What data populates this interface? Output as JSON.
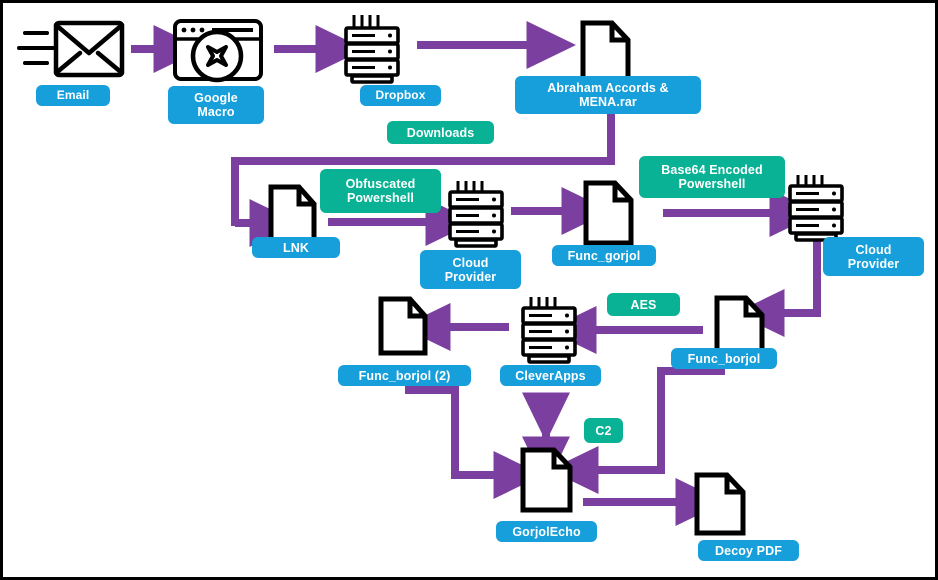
{
  "diagram": {
    "title": "Attack chain flow diagram",
    "colors": {
      "blue_label": "#169FDB",
      "teal_label": "#09B294",
      "arrow_purple": "#7B3FA0",
      "icon_black": "#000000",
      "background": "#FFFFFF",
      "border": "#000000"
    },
    "nodes": [
      {
        "id": "email",
        "label": "Email",
        "chip": "blue",
        "icon": "email-icon"
      },
      {
        "id": "google-macro",
        "label": "Google\nMacro",
        "chip": "blue",
        "icon": "browser-error-icon"
      },
      {
        "id": "dropbox",
        "label": "Dropbox",
        "chip": "blue",
        "icon": "server-icon"
      },
      {
        "id": "rar",
        "label": "Abraham Accords &\nMENA.rar",
        "chip": "blue",
        "icon": "document-icon"
      },
      {
        "id": "lnk",
        "label": "LNK",
        "chip": "blue",
        "icon": "document-icon"
      },
      {
        "id": "cloud1",
        "label": "Cloud\nProvider",
        "chip": "blue",
        "icon": "server-icon"
      },
      {
        "id": "func-gorjol",
        "label": "Func_gorjol",
        "chip": "blue",
        "icon": "document-icon"
      },
      {
        "id": "cloud2",
        "label": "Cloud\nProvider",
        "chip": "blue",
        "icon": "server-icon"
      },
      {
        "id": "func-borjol",
        "label": "Func_borjol",
        "chip": "blue",
        "icon": "document-icon"
      },
      {
        "id": "cleverapps",
        "label": "CleverApps",
        "chip": "blue",
        "icon": "server-icon"
      },
      {
        "id": "func-borjol2",
        "label": "Func_borjol (2)",
        "chip": "blue",
        "icon": "document-icon"
      },
      {
        "id": "gorjolecho",
        "label": "GorjolEcho",
        "chip": "blue",
        "icon": "document-icon"
      },
      {
        "id": "decoy-pdf",
        "label": "Decoy PDF",
        "chip": "blue",
        "icon": "document-icon"
      }
    ],
    "edge_labels": [
      {
        "id": "downloads",
        "label": "Downloads",
        "chip": "teal"
      },
      {
        "id": "obfuscated",
        "label": "Obfuscated\nPowershell",
        "chip": "teal"
      },
      {
        "id": "base64",
        "label": "Base64 Encoded\nPowershell",
        "chip": "teal"
      },
      {
        "id": "aes",
        "label": "AES",
        "chip": "teal"
      },
      {
        "id": "c2",
        "label": "C2",
        "chip": "teal"
      }
    ],
    "edges": [
      {
        "from": "email",
        "to": "google-macro",
        "kind": "straight-right"
      },
      {
        "from": "google-macro",
        "to": "dropbox",
        "kind": "straight-right"
      },
      {
        "from": "dropbox",
        "to": "rar",
        "kind": "straight-right",
        "label": "Downloads"
      },
      {
        "from": "rar",
        "to": "lnk",
        "kind": "down-left-down-right"
      },
      {
        "from": "lnk",
        "to": "cloud1",
        "kind": "straight-right",
        "label": "Obfuscated Powershell"
      },
      {
        "from": "cloud1",
        "to": "func-gorjol",
        "kind": "straight-right"
      },
      {
        "from": "func-gorjol",
        "to": "cloud2",
        "kind": "straight-right",
        "label": "Base64 Encoded Powershell"
      },
      {
        "from": "cloud2",
        "to": "func-borjol",
        "kind": "down-left"
      },
      {
        "from": "func-borjol",
        "to": "cleverapps",
        "kind": "straight-left",
        "label": "AES"
      },
      {
        "from": "cleverapps",
        "to": "func-borjol2",
        "kind": "straight-left"
      },
      {
        "from": "func-borjol2",
        "to": "gorjolecho",
        "kind": "right-down-right"
      },
      {
        "from": "cleverapps",
        "to": "gorjolecho",
        "kind": "bidirectional-vertical"
      },
      {
        "from": "func-borjol",
        "to": "gorjolecho",
        "kind": "down-left-arrow",
        "label": "C2"
      },
      {
        "from": "gorjolecho",
        "to": "decoy-pdf",
        "kind": "straight-right"
      }
    ]
  }
}
